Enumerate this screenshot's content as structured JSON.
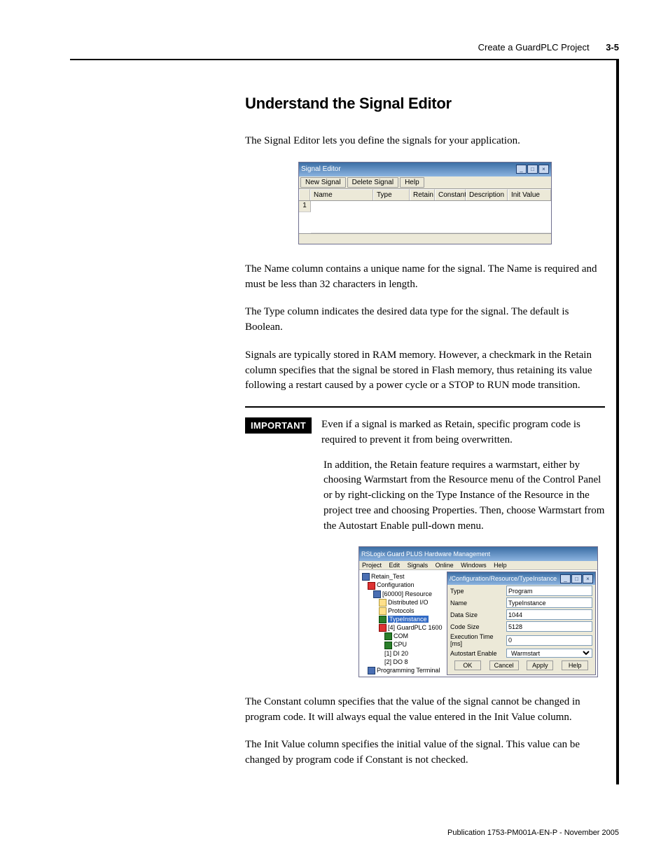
{
  "header": {
    "section": "Create a GuardPLC Project",
    "page": "3-5"
  },
  "h2": "Understand the Signal Editor",
  "p_intro": "The Signal Editor lets you define the signals for your application.",
  "sigeditor": {
    "title": "Signal Editor",
    "toolbar": {
      "new": "New Signal",
      "delete": "Delete Signal",
      "help": "Help"
    },
    "cols": {
      "name": "Name",
      "type": "Type",
      "retain": "Retain",
      "constant": "Constant",
      "description": "Description",
      "init": "Init Value"
    },
    "rownum": "1"
  },
  "p_name": "The Name column contains a unique name for the signal. The Name is required and must be less than 32 characters in length.",
  "p_type": "The Type column indicates the desired data type for the signal. The default is Boolean.",
  "p_retain": "Signals are typically stored in RAM memory. However, a checkmark in the Retain column specifies that the signal be stored in Flash memory, thus retaining its value following a restart caused by a power cycle or a STOP to RUN mode transition.",
  "important": {
    "label": "IMPORTANT",
    "p1": "Even if a signal is marked as Retain, specific program code is required to prevent it from being overwritten.",
    "p2": "In addition, the Retain feature requires a warmstart, either by choosing Warmstart from the Resource menu of the Control Panel or by right-clicking on the Type Instance of the Resource in the project tree and choosing Properties. Then, choose Warmstart from the Autostart Enable pull-down menu."
  },
  "hw": {
    "title": "RSLogix Guard PLUS Hardware Management",
    "menu": {
      "project": "Project",
      "edit": "Edit",
      "signals": "Signals",
      "online": "Online",
      "windows": "Windows",
      "help": "Help"
    },
    "tree": {
      "root": "Retain_Test",
      "config": "Configuration",
      "resource": "[60000] Resource",
      "dio": "Distributed I/O",
      "protocols": "Protocols",
      "typeinst": "TypeInstance",
      "guardplc": "[4] GuardPLC 1600",
      "com": "COM",
      "cpu": "CPU",
      "di": "[1] DI 20",
      "do": "[2] DO 8",
      "progterm": "Programming Terminal"
    },
    "prop": {
      "title": "/Configuration/Resource/TypeInstance",
      "type_l": "Type",
      "type_v": "Program",
      "name_l": "Name",
      "name_v": "TypeInstance",
      "dsize_l": "Data Size",
      "dsize_v": "1044",
      "csize_l": "Code Size",
      "csize_v": "5128",
      "exec_l": "Execution Time [ms]",
      "exec_v": "0",
      "auto_l": "Autostart Enable",
      "auto_v": "Warmstart",
      "ok": "OK",
      "cancel": "Cancel",
      "apply": "Apply",
      "help": "Help"
    }
  },
  "p_constant": "The Constant column specifies that the value of the signal cannot be changed in program code. It will always equal the value entered in the Init Value column.",
  "p_init": "The Init Value column specifies the initial value of the signal. This value can be changed by program code if Constant is not checked.",
  "footer": "Publication 1753-PM001A-EN-P - November 2005"
}
